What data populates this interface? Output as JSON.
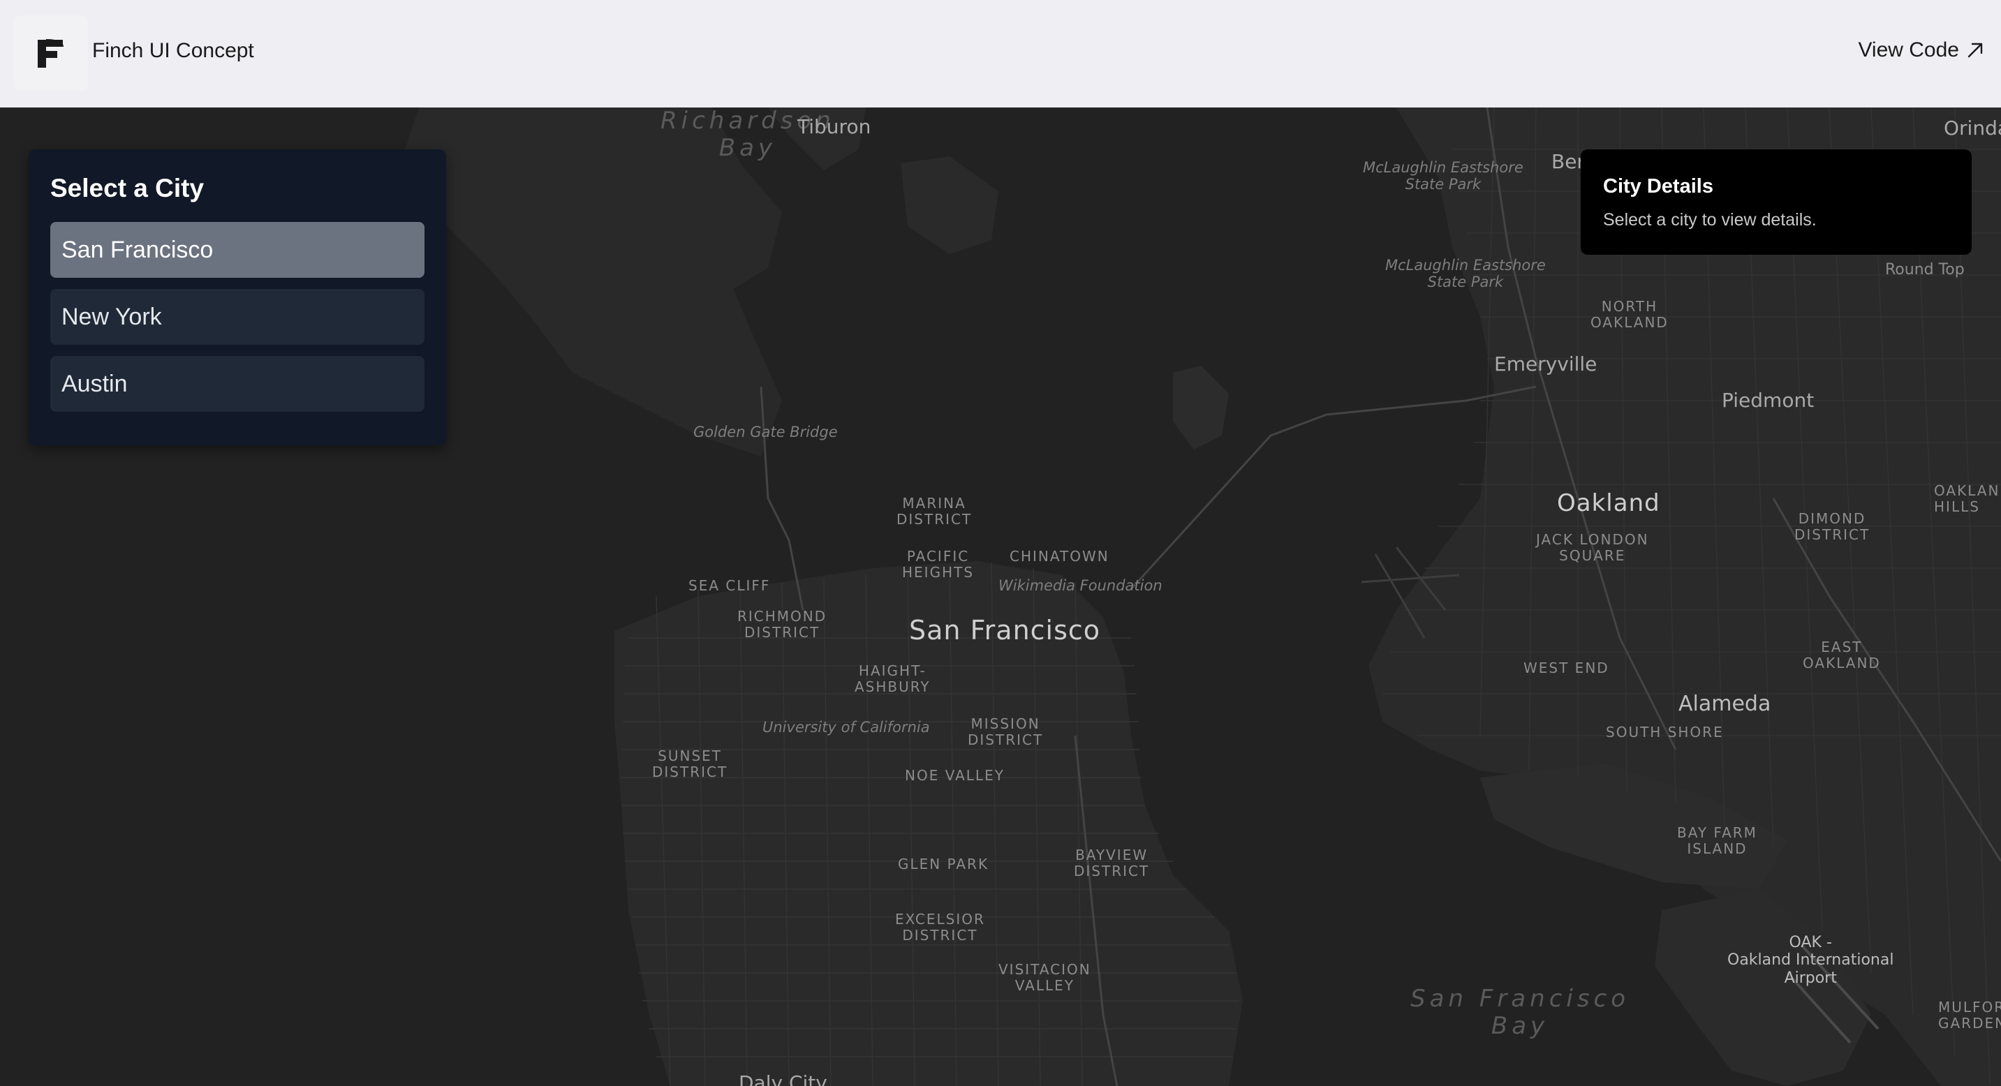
{
  "header": {
    "app_title": "Finch UI Concept",
    "view_code_label": "View Code",
    "logo_icon": "finch-logo-icon",
    "view_code_icon": "arrow-up-right-icon"
  },
  "city_panel": {
    "title": "Select a City",
    "cities": [
      "San Francisco",
      "New York",
      "Austin"
    ],
    "selected": "San Francisco"
  },
  "details": {
    "title": "City Details",
    "body": "Select a city to view details."
  },
  "map": {
    "theme_colors": {
      "water": "#222222",
      "land": "#2a2a2a",
      "road": "#3a3a3a"
    },
    "labels": {
      "richardson_bay": "Richardson\nBay",
      "tiburon": "Tiburon",
      "golden_gate_bridge": "Golden Gate Bridge",
      "marina": "MARINA\nDISTRICT",
      "pacific_heights": "PACIFIC\nHEIGHTS",
      "chinatown": "CHINATOWN",
      "wikimedia": "Wikimedia Foundation",
      "sea_cliff": "SEA CLIFF",
      "richmond": "RICHMOND\nDISTRICT",
      "san_francisco": "San Francisco",
      "haight": "HAIGHT-\nASHBURY",
      "ucsf": "University of California",
      "mission": "MISSION\nDISTRICT",
      "sunset": "SUNSET\nDISTRICT",
      "noe_valley": "NOE VALLEY",
      "glen_park": "GLEN PARK",
      "bayview": "BAYVIEW\nDISTRICT",
      "excelsior": "EXCELSIOR\nDISTRICT",
      "visitacion": "VISITACION\nVALLEY",
      "daly_city": "Daly City",
      "mclaughlin_1": "McLaughlin Eastshore\nState Park",
      "mclaughlin_2": "McLaughlin Eastshore\nState Park",
      "berkeley_partial": "Ber",
      "orinda_partial": "Orinda",
      "round_top": "Round Top",
      "north_oakland": "NORTH\nOAKLAND",
      "emeryville": "Emeryville",
      "piedmont": "Piedmont",
      "oakland": "Oakland",
      "oakland_hills": "OAKLAN\nHILLS",
      "jack_london": "JACK LONDON\nSQUARE",
      "dimond": "DIMOND\nDISTRICT",
      "west_end": "WEST END",
      "east_oakland": "EAST\nOAKLAND",
      "alameda": "Alameda",
      "south_shore": "SOUTH SHORE",
      "bay_farm": "BAY FARM\nISLAND",
      "oak_airport": "OAK -\nOakland International\nAirport",
      "sf_bay": "San Francisco\nBay",
      "mulford": "MULFOR\nGARDEN"
    }
  }
}
